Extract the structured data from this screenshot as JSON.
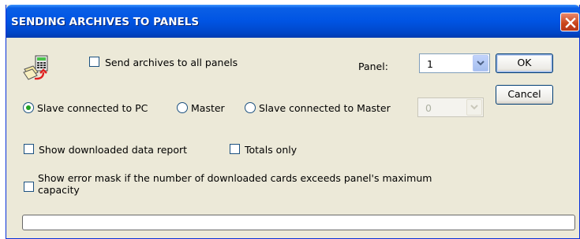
{
  "window": {
    "title": "SENDING ARCHIVES TO PANELS"
  },
  "icons": {
    "app": "panel-archive-icon",
    "close": "close-icon",
    "dropdown": "chevron-down-icon"
  },
  "options": {
    "send_all": {
      "label": "Send archives to all panels",
      "checked": false
    },
    "show_report": {
      "label": "Show downloaded data report",
      "checked": false
    },
    "totals_only": {
      "label": "Totals only",
      "checked": false
    },
    "error_mask": {
      "label_line1": "Show error mask if the number of downloaded cards exceeds panel's maximum",
      "label_line2": "capacity",
      "checked": false
    }
  },
  "panel": {
    "label": "Panel:",
    "value": "1"
  },
  "connection": {
    "selected": "slave_pc",
    "slave_pc": "Slave connected to PC",
    "master": "Master",
    "slave_master": "Slave connected to Master"
  },
  "master_panel": {
    "value": "0",
    "disabled": true
  },
  "buttons": {
    "ok": "OK",
    "cancel": "Cancel"
  },
  "progress": {
    "value": 0
  },
  "colors": {
    "titlebar": "#0054e3",
    "dialog_bg": "#ece9d8",
    "close": "#c8441a",
    "radio_dot": "#21a121"
  }
}
